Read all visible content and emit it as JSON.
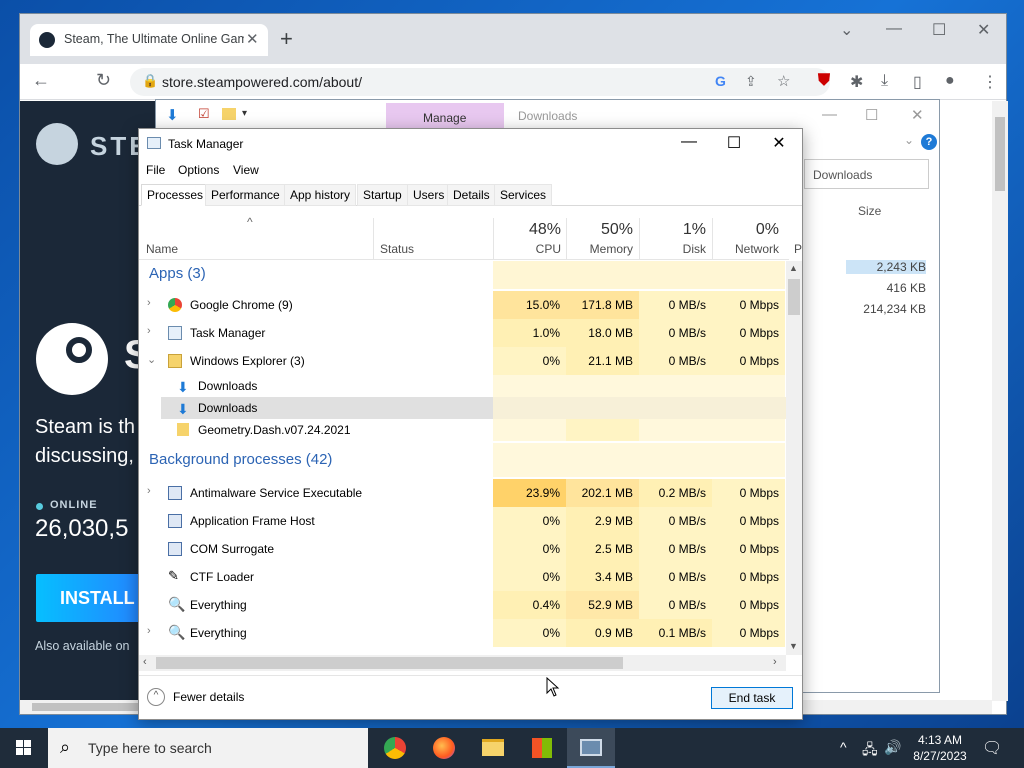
{
  "chrome": {
    "tab_title": "Steam, The Ultimate Online Gam",
    "url": "store.steampowered.com/about/"
  },
  "steam": {
    "logo_text": "STE",
    "big_letter": "S",
    "tagline": "Steam is th\ndiscussing,",
    "online_label": "ONLINE",
    "online_count": "26,030,5",
    "install_label": "INSTALL",
    "also_available": "Also available on"
  },
  "explorer": {
    "manage_label": "Manage",
    "title": "Downloads",
    "search_placeholder": "Downloads",
    "size_header": "Size",
    "sizes": [
      "2,243 KB",
      "416 KB",
      "214,234 KB"
    ]
  },
  "taskmanager": {
    "title": "Task Manager",
    "menu": [
      "File",
      "Options",
      "View"
    ],
    "tabs": [
      "Processes",
      "Performance",
      "App history",
      "Startup",
      "Users",
      "Details",
      "Services"
    ],
    "columns": {
      "name": "Name",
      "status": "Status",
      "cpu_pct": "48%",
      "cpu": "CPU",
      "mem_pct": "50%",
      "mem": "Memory",
      "disk_pct": "1%",
      "disk": "Disk",
      "net_pct": "0%",
      "net": "Network"
    },
    "groups": {
      "apps": "Apps (3)",
      "background": "Background processes (42)"
    },
    "apps": [
      {
        "name": "Google Chrome (9)",
        "cpu": "15.0%",
        "mem": "171.8 MB",
        "disk": "0 MB/s",
        "net": "0 Mbps"
      },
      {
        "name": "Task Manager",
        "cpu": "1.0%",
        "mem": "18.0 MB",
        "disk": "0 MB/s",
        "net": "0 Mbps"
      },
      {
        "name": "Windows Explorer (3)",
        "cpu": "0%",
        "mem": "21.1 MB",
        "disk": "0 MB/s",
        "net": "0 Mbps"
      }
    ],
    "explorer_children": [
      "Downloads",
      "Downloads",
      "Geometry.Dash.v07.24.2021"
    ],
    "background": [
      {
        "name": "Antimalware Service Executable",
        "cpu": "23.9%",
        "mem": "202.1 MB",
        "disk": "0.2 MB/s",
        "net": "0 Mbps"
      },
      {
        "name": "Application Frame Host",
        "cpu": "0%",
        "mem": "2.9 MB",
        "disk": "0 MB/s",
        "net": "0 Mbps"
      },
      {
        "name": "COM Surrogate",
        "cpu": "0%",
        "mem": "2.5 MB",
        "disk": "0 MB/s",
        "net": "0 Mbps"
      },
      {
        "name": "CTF Loader",
        "cpu": "0%",
        "mem": "3.4 MB",
        "disk": "0 MB/s",
        "net": "0 Mbps"
      },
      {
        "name": "Everything",
        "cpu": "0.4%",
        "mem": "52.9 MB",
        "disk": "0 MB/s",
        "net": "0 Mbps"
      },
      {
        "name": "Everything",
        "cpu": "0%",
        "mem": "0.9 MB",
        "disk": "0.1 MB/s",
        "net": "0 Mbps"
      }
    ],
    "fewer_details": "Fewer details",
    "end_task": "End task"
  },
  "taskbar": {
    "search_placeholder": "Type here to search",
    "time": "4:13 AM",
    "date": "8/27/2023"
  }
}
